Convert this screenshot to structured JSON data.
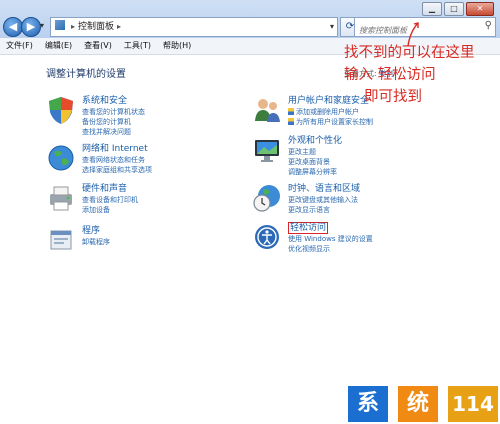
{
  "address": {
    "breadcrumb": "控制面板",
    "search_placeholder": "搜索控制面板"
  },
  "window_controls": [
    "▁",
    "□",
    "✕"
  ],
  "menu": [
    "文件(F)",
    "编辑(E)",
    "查看(V)",
    "工具(T)",
    "帮助(H)"
  ],
  "page_title": "调整计算机的设置",
  "view_by": {
    "label": "查看方式:",
    "value": "类别"
  },
  "categories_left": [
    {
      "title": "系统和安全",
      "icon": "shield-flag-icon",
      "links": [
        "查看您的计算机状态",
        "备份您的计算机",
        "查找并解决问题"
      ]
    },
    {
      "title": "网络和 Internet",
      "icon": "globe-network-icon",
      "links": [
        "查看网络状态和任务",
        "选择家庭组和共享选项"
      ]
    },
    {
      "title": "硬件和声音",
      "icon": "printer-icon",
      "links": [
        "查看设备和打印机",
        "添加设备"
      ]
    },
    {
      "title": "程序",
      "icon": "programs-icon",
      "links": [
        "卸载程序"
      ]
    }
  ],
  "categories_right": [
    {
      "title": "用户帐户和家庭安全",
      "icon": "users-icon",
      "links": [
        "添加或删除用户帐户",
        "为所有用户设置家长控制"
      ],
      "shield_links": [
        true,
        true
      ]
    },
    {
      "title": "外观和个性化",
      "icon": "display-icon",
      "links": [
        "更改主题",
        "更改桌面背景",
        "调整屏幕分辨率"
      ]
    },
    {
      "title": "时钟、语言和区域",
      "icon": "clock-globe-icon",
      "links": [
        "更改键盘或其他输入法",
        "更改显示语言"
      ]
    },
    {
      "title": "轻松访问",
      "icon": "ease-of-access-icon",
      "links": [
        "使用 Windows 建议的设置",
        "优化视频显示"
      ]
    }
  ],
  "annotation": {
    "line1": "找不到的可以在这里",
    "line2": "输入  轻松访问",
    "line3": "即可找到"
  },
  "watermark": [
    "系",
    "统",
    "114"
  ],
  "colors": {
    "annotation": "#d82a22",
    "link": "#2a68b0",
    "title": "#1a5ea8"
  }
}
